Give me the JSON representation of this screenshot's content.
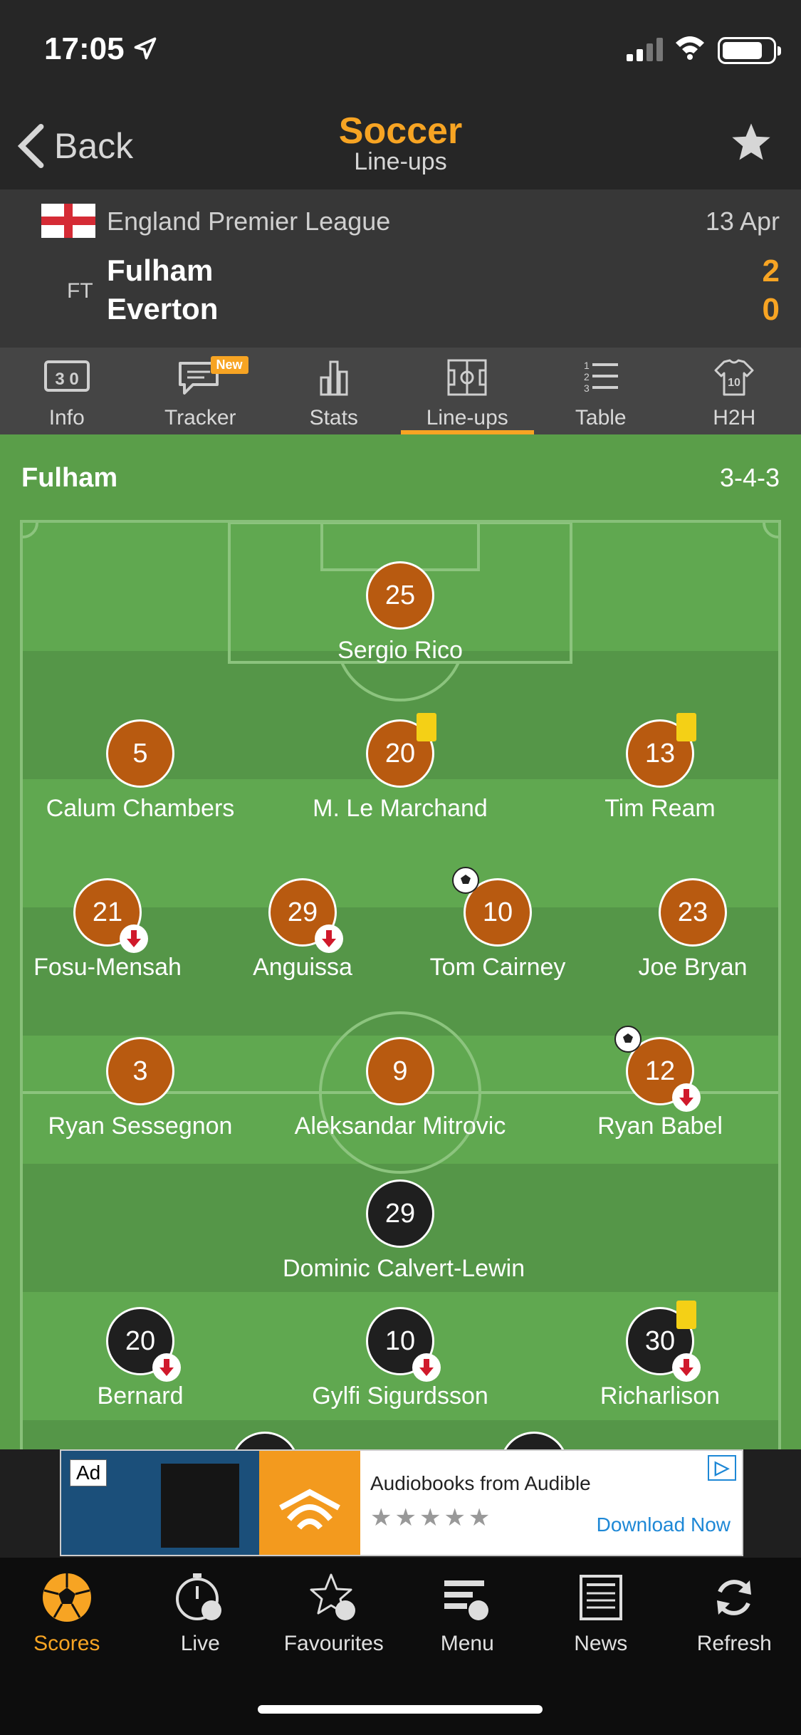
{
  "status": {
    "time": "17:05"
  },
  "nav": {
    "back_label": "Back",
    "title": "Soccer",
    "subtitle": "Line-ups"
  },
  "match": {
    "league": "England Premier League",
    "date": "13 Apr",
    "status": "FT",
    "home_team": "Fulham",
    "away_team": "Everton",
    "home_score": "2",
    "away_score": "0"
  },
  "tabs": [
    {
      "label": "Info",
      "icon": "scoreboard-icon"
    },
    {
      "label": "Tracker",
      "icon": "chat-icon",
      "badge": "New"
    },
    {
      "label": "Stats",
      "icon": "bar-chart-icon"
    },
    {
      "label": "Line-ups",
      "icon": "pitch-icon",
      "active": true
    },
    {
      "label": "Table",
      "icon": "list-icon"
    },
    {
      "label": "H2H",
      "icon": "jersey-icon"
    }
  ],
  "lineup": {
    "team": "Fulham",
    "formation": "3-4-3",
    "home_players": [
      {
        "number": "25",
        "name": "Sergio Rico"
      },
      {
        "number": "5",
        "name": "Calum Chambers"
      },
      {
        "number": "20",
        "name": "M. Le Marchand",
        "yellow_card": true
      },
      {
        "number": "13",
        "name": "Tim Ream",
        "yellow_card": true
      },
      {
        "number": "21",
        "name": "Fosu-Mensah",
        "subbed_off": true
      },
      {
        "number": "29",
        "name": "Anguissa",
        "subbed_off": true
      },
      {
        "number": "10",
        "name": "Tom Cairney",
        "goal": true
      },
      {
        "number": "23",
        "name": "Joe Bryan"
      },
      {
        "number": "3",
        "name": "Ryan Sessegnon"
      },
      {
        "number": "9",
        "name": "Aleksandar Mitrovic"
      },
      {
        "number": "12",
        "name": "Ryan Babel",
        "goal": true,
        "subbed_off": true
      }
    ],
    "away_players": [
      {
        "number": "29",
        "name": "Dominic Calvert-Lewin"
      },
      {
        "number": "20",
        "name": "Bernard",
        "subbed_off": true
      },
      {
        "number": "10",
        "name": "Gylfi Sigurdsson",
        "subbed_off": true
      },
      {
        "number": "30",
        "name": "Richarlison",
        "yellow_card": true,
        "subbed_off": true
      }
    ]
  },
  "ad": {
    "tag": "Ad",
    "title": "Audiobooks from Audible",
    "stars": "★★★★★",
    "cta": "Download Now"
  },
  "bottom_nav": [
    {
      "label": "Scores",
      "icon": "soccer-ball-icon",
      "active": true
    },
    {
      "label": "Live",
      "icon": "stopwatch-ball-icon"
    },
    {
      "label": "Favourites",
      "icon": "star-ball-icon"
    },
    {
      "label": "Menu",
      "icon": "menu-ball-icon"
    },
    {
      "label": "News",
      "icon": "newspaper-icon"
    },
    {
      "label": "Refresh",
      "icon": "refresh-icon"
    }
  ],
  "colors": {
    "accent": "#f7a423",
    "home_kit": "#b85a10",
    "away_kit": "#1f1f1f",
    "pitch": "#5a9e49"
  }
}
